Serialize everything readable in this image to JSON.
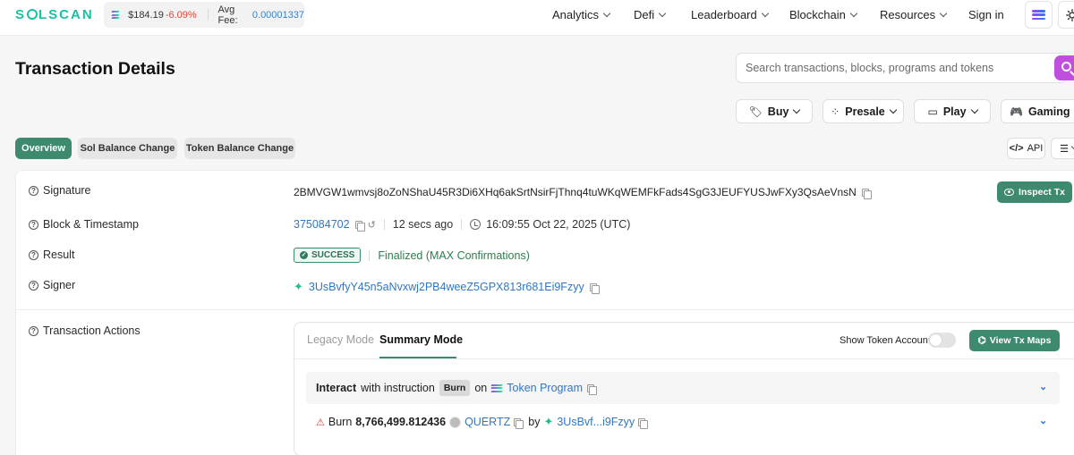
{
  "nav": {
    "logo_pre": "S",
    "logo_post": "LSCAN",
    "price": "$184.19",
    "price_change": "-6.09%",
    "avg_fee_label": "Avg Fee:",
    "avg_fee_value": "0.00001337",
    "items": [
      "Analytics",
      "Defi",
      "Leaderboard",
      "Blockchain",
      "Resources"
    ],
    "sign_in": "Sign in"
  },
  "header": {
    "title": "Transaction Details",
    "search_placeholder": "Search transactions, blocks, programs and tokens"
  },
  "promo": {
    "buy": "Buy",
    "presale": "Presale",
    "play": "Play",
    "gaming": "Gaming"
  },
  "tabs": {
    "overview": "Overview",
    "sol_balance": "Sol Balance Change",
    "token_balance": "Token Balance Change",
    "api": "API"
  },
  "details": {
    "signature_label": "Signature",
    "signature": "2BMVGW1wmvsj8oZoNShaU45R3Di6XHq6akSrtNsirFjThnq4tuWKqWEMFkFads4SgG3JEUFYUSJwFXy3QsAeVnsN",
    "inspect_tx": "Inspect Tx",
    "block_label": "Block & Timestamp",
    "block": "375084702",
    "ago": "12 secs ago",
    "timestamp": "16:09:55 Oct 22, 2025 (UTC)",
    "result_label": "Result",
    "result_badge": "SUCCESS",
    "result_text": "Finalized (MAX Confirmations)",
    "signer_label": "Signer",
    "signer": "3UsBvfyY45n5aNvxwj2PB4weeZ5GPX813r681Ei9Fzyy",
    "actions_label": "Transaction Actions"
  },
  "actions": {
    "legacy_mode": "Legacy Mode",
    "summary_mode": "Summary Mode",
    "show_token_account": "Show Token Account",
    "view_tx_maps": "View Tx Maps",
    "interact": "Interact",
    "with_instruction": "with instruction",
    "instruction_badge": "Burn",
    "on": "on",
    "program": "Token Program",
    "burn_label": "Burn",
    "burn_amount": "8,766,499.812436",
    "token": "QUERTZ",
    "by": "by",
    "by_address": "3UsBvf...i9Fzyy"
  }
}
